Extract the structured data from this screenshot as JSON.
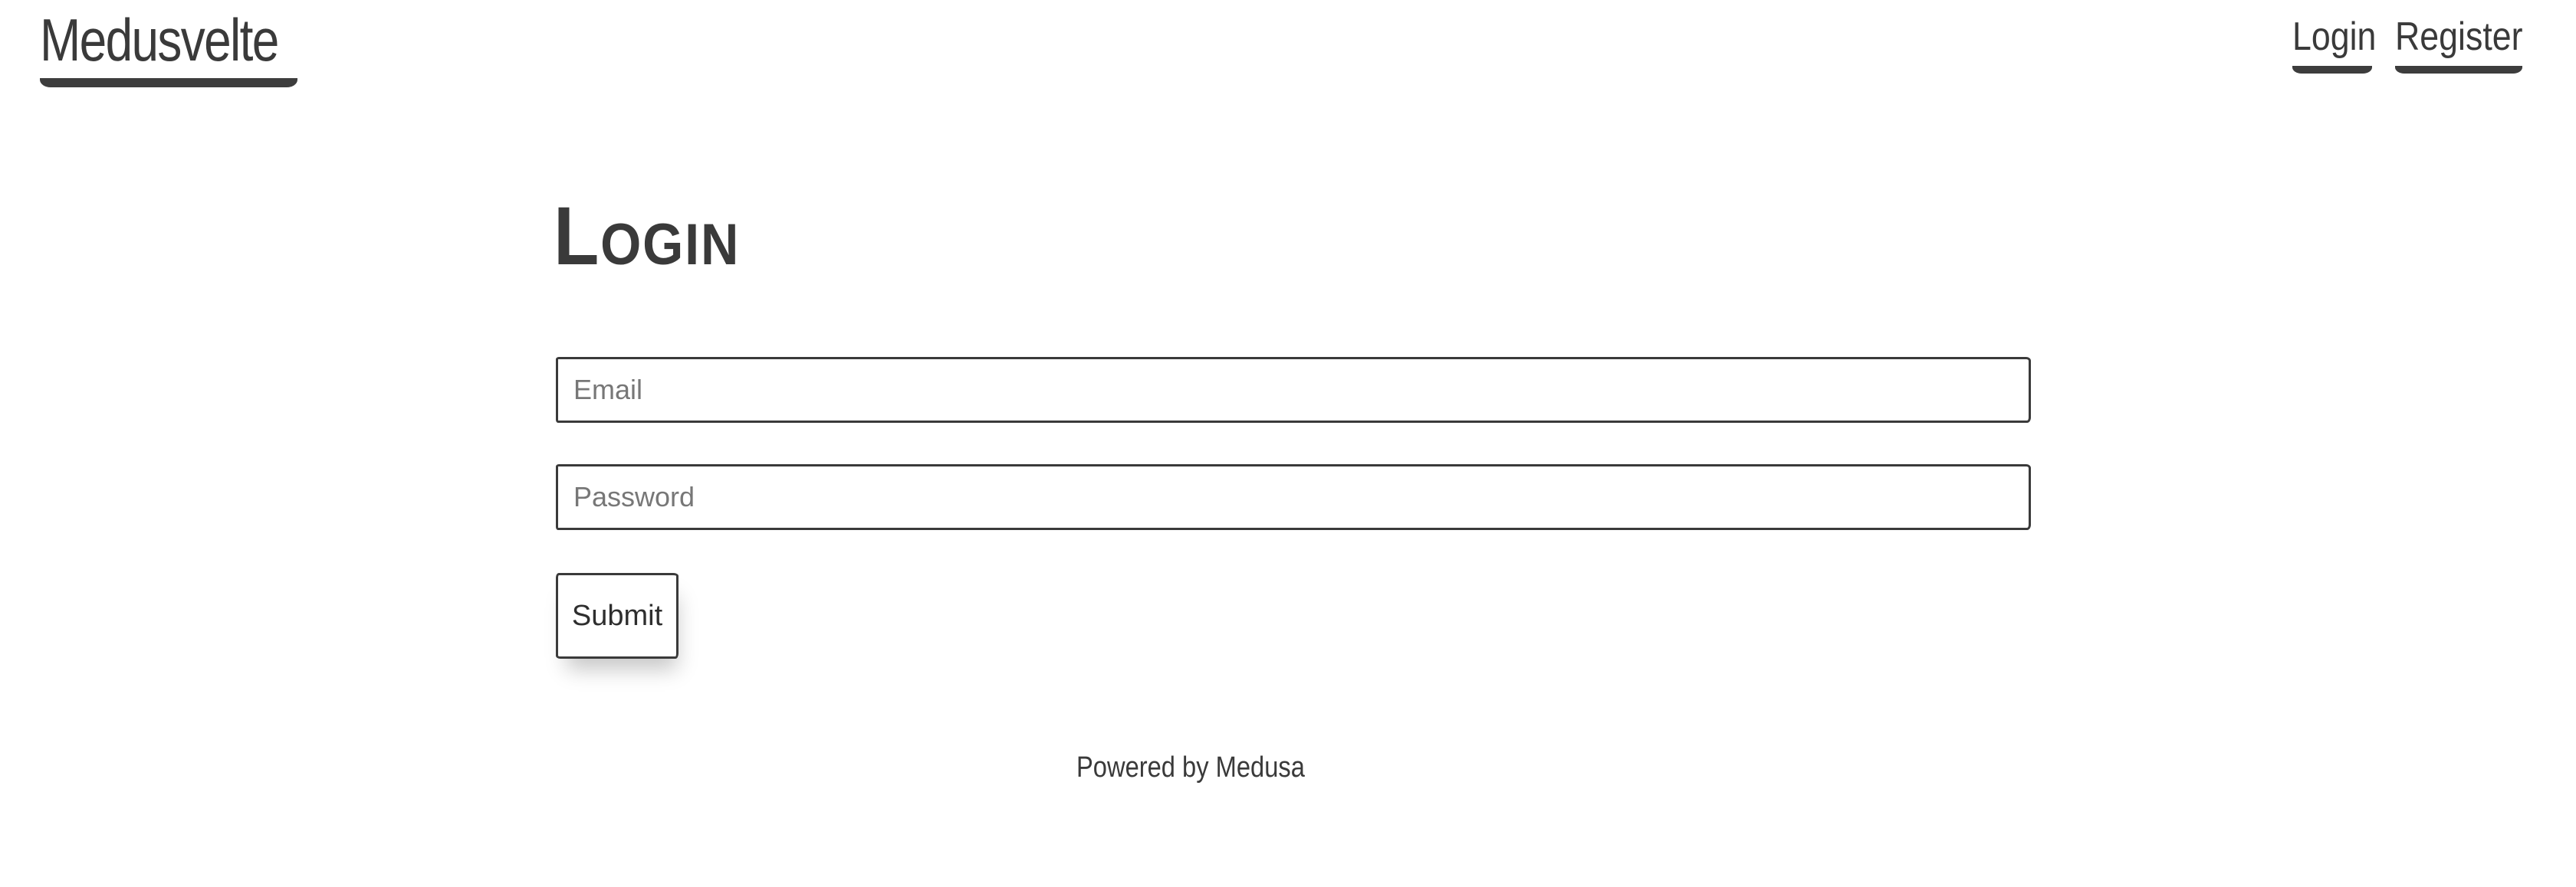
{
  "header": {
    "brand": "Medusvelte",
    "nav": [
      {
        "label": "Login"
      },
      {
        "label": "Register"
      }
    ]
  },
  "main": {
    "title": "Login",
    "form": {
      "email": {
        "placeholder": "Email",
        "value": ""
      },
      "password": {
        "placeholder": "Password",
        "value": ""
      },
      "submit_label": "Submit"
    }
  },
  "footer": {
    "text": "Powered by Medusa"
  },
  "colors": {
    "ink": "#3a3a3a",
    "background": "#ffffff",
    "placeholder": "#777777"
  }
}
